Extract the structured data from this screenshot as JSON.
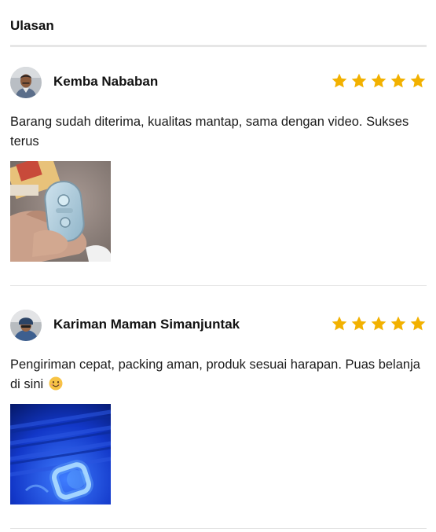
{
  "section": {
    "title": "Ulasan"
  },
  "colors": {
    "star": "#F2B100",
    "divider": "#E3E3E3",
    "text": "#1A1A1A"
  },
  "reviews": [
    {
      "name": "Kemba Nababan",
      "rating": 5,
      "text": "Barang sudah diterima, kualitas mantap, sama dengan video. Sukses terus",
      "emoji": "",
      "photo_icon": "led-module-in-hand-photo",
      "avatar_icon": "avatar-man-photo"
    },
    {
      "name": "Kariman Maman Simanjuntak",
      "rating": 5,
      "text": "Pengiriman cepat, packing aman, produk sesuai harapan. Puas belanja di sini",
      "emoji": "😊",
      "photo_icon": "blue-led-light-photo",
      "avatar_icon": "avatar-man-helmet-photo"
    }
  ]
}
